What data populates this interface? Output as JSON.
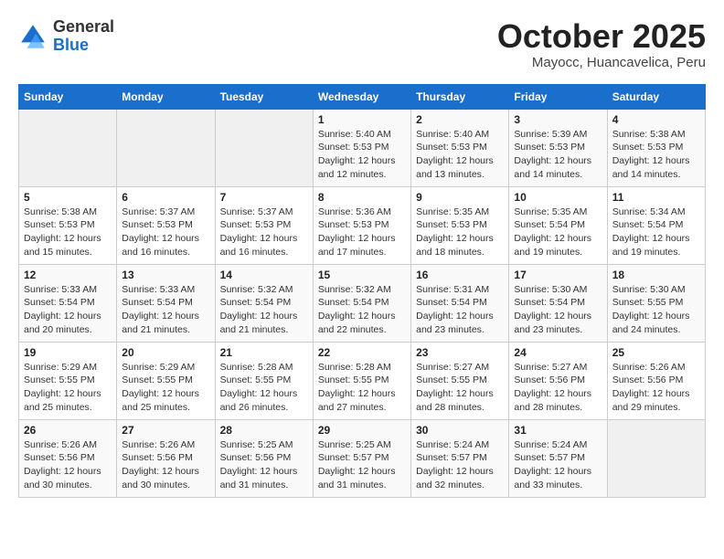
{
  "header": {
    "logo_line1": "General",
    "logo_line2": "Blue",
    "month": "October 2025",
    "location": "Mayocc, Huancavelica, Peru"
  },
  "days_of_week": [
    "Sunday",
    "Monday",
    "Tuesday",
    "Wednesday",
    "Thursday",
    "Friday",
    "Saturday"
  ],
  "weeks": [
    [
      {
        "day": "",
        "info": ""
      },
      {
        "day": "",
        "info": ""
      },
      {
        "day": "",
        "info": ""
      },
      {
        "day": "1",
        "info": "Sunrise: 5:40 AM\nSunset: 5:53 PM\nDaylight: 12 hours\nand 12 minutes."
      },
      {
        "day": "2",
        "info": "Sunrise: 5:40 AM\nSunset: 5:53 PM\nDaylight: 12 hours\nand 13 minutes."
      },
      {
        "day": "3",
        "info": "Sunrise: 5:39 AM\nSunset: 5:53 PM\nDaylight: 12 hours\nand 14 minutes."
      },
      {
        "day": "4",
        "info": "Sunrise: 5:38 AM\nSunset: 5:53 PM\nDaylight: 12 hours\nand 14 minutes."
      }
    ],
    [
      {
        "day": "5",
        "info": "Sunrise: 5:38 AM\nSunset: 5:53 PM\nDaylight: 12 hours\nand 15 minutes."
      },
      {
        "day": "6",
        "info": "Sunrise: 5:37 AM\nSunset: 5:53 PM\nDaylight: 12 hours\nand 16 minutes."
      },
      {
        "day": "7",
        "info": "Sunrise: 5:37 AM\nSunset: 5:53 PM\nDaylight: 12 hours\nand 16 minutes."
      },
      {
        "day": "8",
        "info": "Sunrise: 5:36 AM\nSunset: 5:53 PM\nDaylight: 12 hours\nand 17 minutes."
      },
      {
        "day": "9",
        "info": "Sunrise: 5:35 AM\nSunset: 5:53 PM\nDaylight: 12 hours\nand 18 minutes."
      },
      {
        "day": "10",
        "info": "Sunrise: 5:35 AM\nSunset: 5:54 PM\nDaylight: 12 hours\nand 19 minutes."
      },
      {
        "day": "11",
        "info": "Sunrise: 5:34 AM\nSunset: 5:54 PM\nDaylight: 12 hours\nand 19 minutes."
      }
    ],
    [
      {
        "day": "12",
        "info": "Sunrise: 5:33 AM\nSunset: 5:54 PM\nDaylight: 12 hours\nand 20 minutes."
      },
      {
        "day": "13",
        "info": "Sunrise: 5:33 AM\nSunset: 5:54 PM\nDaylight: 12 hours\nand 21 minutes."
      },
      {
        "day": "14",
        "info": "Sunrise: 5:32 AM\nSunset: 5:54 PM\nDaylight: 12 hours\nand 21 minutes."
      },
      {
        "day": "15",
        "info": "Sunrise: 5:32 AM\nSunset: 5:54 PM\nDaylight: 12 hours\nand 22 minutes."
      },
      {
        "day": "16",
        "info": "Sunrise: 5:31 AM\nSunset: 5:54 PM\nDaylight: 12 hours\nand 23 minutes."
      },
      {
        "day": "17",
        "info": "Sunrise: 5:30 AM\nSunset: 5:54 PM\nDaylight: 12 hours\nand 23 minutes."
      },
      {
        "day": "18",
        "info": "Sunrise: 5:30 AM\nSunset: 5:55 PM\nDaylight: 12 hours\nand 24 minutes."
      }
    ],
    [
      {
        "day": "19",
        "info": "Sunrise: 5:29 AM\nSunset: 5:55 PM\nDaylight: 12 hours\nand 25 minutes."
      },
      {
        "day": "20",
        "info": "Sunrise: 5:29 AM\nSunset: 5:55 PM\nDaylight: 12 hours\nand 25 minutes."
      },
      {
        "day": "21",
        "info": "Sunrise: 5:28 AM\nSunset: 5:55 PM\nDaylight: 12 hours\nand 26 minutes."
      },
      {
        "day": "22",
        "info": "Sunrise: 5:28 AM\nSunset: 5:55 PM\nDaylight: 12 hours\nand 27 minutes."
      },
      {
        "day": "23",
        "info": "Sunrise: 5:27 AM\nSunset: 5:55 PM\nDaylight: 12 hours\nand 28 minutes."
      },
      {
        "day": "24",
        "info": "Sunrise: 5:27 AM\nSunset: 5:56 PM\nDaylight: 12 hours\nand 28 minutes."
      },
      {
        "day": "25",
        "info": "Sunrise: 5:26 AM\nSunset: 5:56 PM\nDaylight: 12 hours\nand 29 minutes."
      }
    ],
    [
      {
        "day": "26",
        "info": "Sunrise: 5:26 AM\nSunset: 5:56 PM\nDaylight: 12 hours\nand 30 minutes."
      },
      {
        "day": "27",
        "info": "Sunrise: 5:26 AM\nSunset: 5:56 PM\nDaylight: 12 hours\nand 30 minutes."
      },
      {
        "day": "28",
        "info": "Sunrise: 5:25 AM\nSunset: 5:56 PM\nDaylight: 12 hours\nand 31 minutes."
      },
      {
        "day": "29",
        "info": "Sunrise: 5:25 AM\nSunset: 5:57 PM\nDaylight: 12 hours\nand 31 minutes."
      },
      {
        "day": "30",
        "info": "Sunrise: 5:24 AM\nSunset: 5:57 PM\nDaylight: 12 hours\nand 32 minutes."
      },
      {
        "day": "31",
        "info": "Sunrise: 5:24 AM\nSunset: 5:57 PM\nDaylight: 12 hours\nand 33 minutes."
      },
      {
        "day": "",
        "info": ""
      }
    ]
  ]
}
